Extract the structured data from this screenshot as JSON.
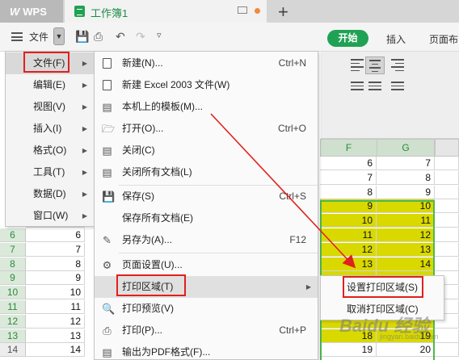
{
  "titlebar": {
    "app_name": "WPS",
    "doc_tab": "工作簿1",
    "new_tab_symbol": "+",
    "unsaved_dot_color": "#f08a3c"
  },
  "toolbar": {
    "file_label": "文件",
    "tabs": [
      "开始",
      "插入",
      "页面布"
    ],
    "accent": "#1fa254"
  },
  "left_menu": {
    "items": [
      {
        "label": "文件(F)",
        "has_submenu": true
      },
      {
        "label": "编辑(E)",
        "has_submenu": true
      },
      {
        "label": "视图(V)",
        "has_submenu": true
      },
      {
        "label": "插入(I)",
        "has_submenu": true
      },
      {
        "label": "格式(O)",
        "has_submenu": true
      },
      {
        "label": "工具(T)",
        "has_submenu": true
      },
      {
        "label": "数据(D)",
        "has_submenu": true
      },
      {
        "label": "窗口(W)",
        "has_submenu": true
      }
    ]
  },
  "file_menu": {
    "items": [
      {
        "label": "新建(N)...",
        "shortcut": "Ctrl+N",
        "icon": "new-doc-icon"
      },
      {
        "label": "新建 Excel 2003 文件(W)",
        "shortcut": "",
        "icon": "new-doc-icon"
      },
      {
        "label": "本机上的模板(M)...",
        "shortcut": "",
        "icon": "template-icon"
      },
      {
        "label": "打开(O)...",
        "shortcut": "Ctrl+O",
        "icon": "folder-icon"
      },
      {
        "label": "关闭(C)",
        "shortcut": "",
        "icon": "close-doc-icon"
      },
      {
        "label": "关闭所有文档(L)",
        "shortcut": "",
        "icon": "close-all-icon"
      },
      {
        "label": "保存(S)",
        "shortcut": "Ctrl+S",
        "icon": "save-icon"
      },
      {
        "label": "保存所有文档(E)",
        "shortcut": "",
        "icon": ""
      },
      {
        "label": "另存为(A)...",
        "shortcut": "F12",
        "icon": "save-as-icon"
      },
      {
        "label": "页面设置(U)...",
        "shortcut": "",
        "icon": "page-setup-icon"
      },
      {
        "label": "打印区域(T)",
        "shortcut": "",
        "icon": ""
      },
      {
        "label": "打印预览(V)",
        "shortcut": "",
        "icon": "print-preview-icon"
      },
      {
        "label": "打印(P)...",
        "shortcut": "Ctrl+P",
        "icon": "printer-icon"
      },
      {
        "label": "输出为PDF格式(F)...",
        "shortcut": "",
        "icon": "pdf-icon"
      }
    ]
  },
  "print_area_submenu": {
    "items": [
      "设置打印区域(S)",
      "取消打印区域(C)"
    ]
  },
  "sheet": {
    "columns": [
      "F",
      "G"
    ],
    "rows": [
      {
        "row": "",
        "e": "",
        "f": "6",
        "g": "7",
        "highlight": false
      },
      {
        "row": "",
        "e": "",
        "f": "7",
        "g": "8",
        "highlight": false
      },
      {
        "row": "",
        "e": "",
        "f": "8",
        "g": "9",
        "highlight": false
      },
      {
        "row": "",
        "e": "",
        "f": "9",
        "g": "10",
        "highlight": true
      },
      {
        "row": "",
        "e": "",
        "f": "10",
        "g": "11",
        "highlight": true
      },
      {
        "row": "6",
        "e": "6",
        "f": "11",
        "g": "12",
        "highlight": true
      },
      {
        "row": "7",
        "e": "7",
        "f": "12",
        "g": "13",
        "highlight": true
      },
      {
        "row": "8",
        "e": "8",
        "f": "13",
        "g": "14",
        "highlight": true
      },
      {
        "row": "9",
        "e": "9",
        "f": "",
        "g": "",
        "highlight": true
      },
      {
        "row": "10",
        "e": "10",
        "f": "",
        "g": "",
        "highlight": true
      },
      {
        "row": "11",
        "e": "11",
        "f": "",
        "g": "",
        "highlight": true
      },
      {
        "row": "12",
        "e": "12",
        "f": "",
        "g": "",
        "highlight": true
      },
      {
        "row": "13",
        "e": "13",
        "f": "18",
        "g": "19",
        "highlight": true
      },
      {
        "row": "14",
        "e": "14",
        "f": "19",
        "g": "20",
        "highlight": false
      }
    ]
  },
  "watermark": {
    "text": "Baidu 经验",
    "sub": "jingyan.baidu.com"
  },
  "annotation_color": "#e0201c",
  "highlight_color": "#d9d900"
}
